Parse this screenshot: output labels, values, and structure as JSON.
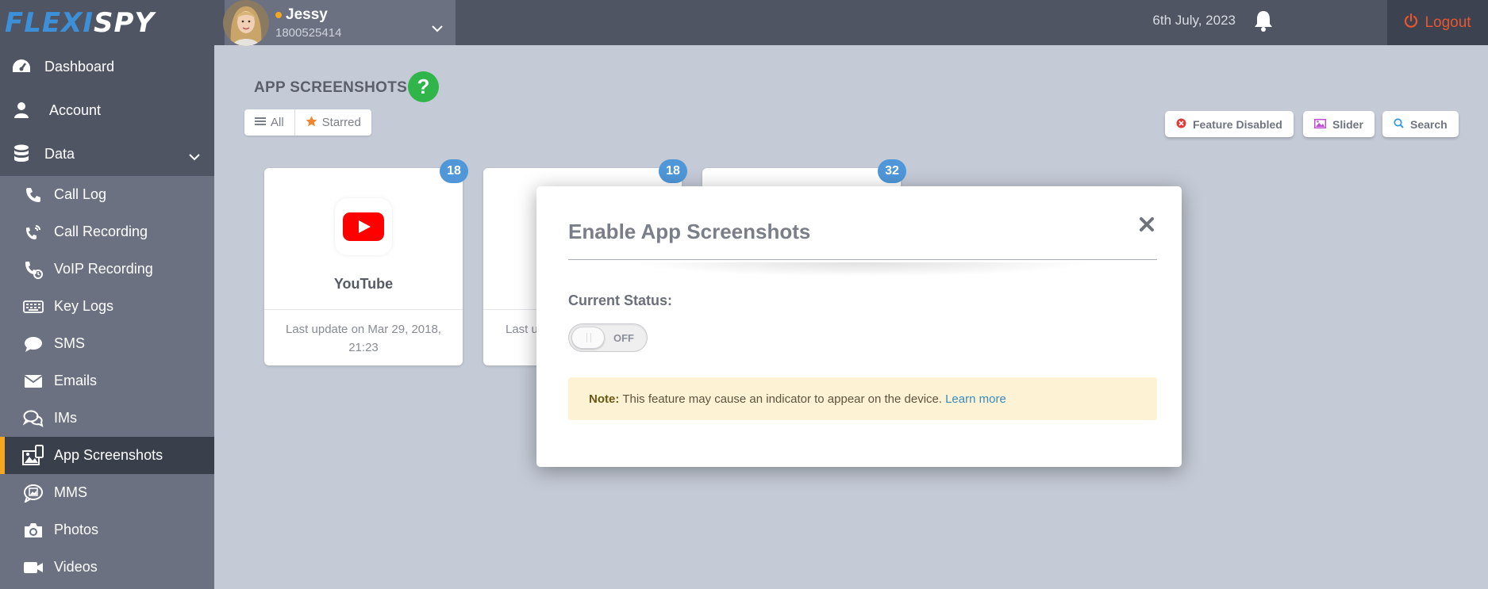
{
  "header": {
    "logo_part1": "FLEXI",
    "logo_part2": "SPY",
    "user_name": "Jessy",
    "user_id": "1800525414",
    "date": "6th July, 2023",
    "logout_label": "Logout"
  },
  "sidebar": {
    "top_items": [
      {
        "label": "Dashboard",
        "icon": "dashboard-icon"
      },
      {
        "label": "Account",
        "icon": "user-icon"
      },
      {
        "label": "Data",
        "icon": "database-icon"
      }
    ],
    "sub_items": [
      {
        "label": "Call Log",
        "icon": "phone-icon"
      },
      {
        "label": "Call Recording",
        "icon": "phone-recording-icon"
      },
      {
        "label": "VoIP Recording",
        "icon": "voip-icon"
      },
      {
        "label": "Key Logs",
        "icon": "keyboard-icon"
      },
      {
        "label": "SMS",
        "icon": "chat-bubble-icon"
      },
      {
        "label": "Emails",
        "icon": "envelope-icon"
      },
      {
        "label": "IMs",
        "icon": "comments-icon"
      },
      {
        "label": "App Screenshots",
        "icon": "app-screenshots-icon",
        "active": true
      },
      {
        "label": "MMS",
        "icon": "mms-icon"
      },
      {
        "label": "Photos",
        "icon": "camera-icon"
      },
      {
        "label": "Videos",
        "icon": "video-icon"
      }
    ]
  },
  "main": {
    "title": "APP SCREENSHOTS",
    "filters": {
      "all": "All",
      "starred": "Starred"
    },
    "tools": {
      "feature_disabled": "Feature Disabled",
      "slider": "Slider",
      "search": "Search"
    },
    "cards": [
      {
        "app_name": "YouTube",
        "updated": "Last update on Mar 29, 2018, 21:23",
        "count": "18"
      },
      {
        "app_name": "",
        "updated": "Last u",
        "count": "18"
      },
      {
        "app_name": "",
        "updated": "",
        "count": "32"
      }
    ]
  },
  "modal": {
    "title": "Enable App Screenshots",
    "status_label": "Current Status:",
    "toggle_text": "OFF",
    "toggle_on": false,
    "note_label": "Note:",
    "note_text": "This feature may cause an indicator to appear on the device.",
    "note_link": "Learn more"
  },
  "colors": {
    "topbar": "#4f5563",
    "sidebar_sub": "#6b7180",
    "active_accent": "#f5a623",
    "help_green": "#2fb54a",
    "badge_blue": "#4f97d9",
    "logout_red": "#e8562f",
    "youtube_red": "#ff0000"
  }
}
